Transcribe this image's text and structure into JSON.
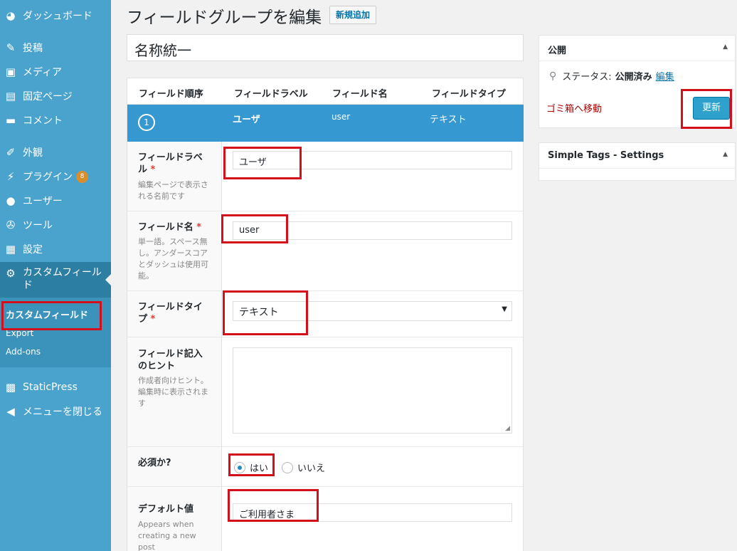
{
  "sidebar": {
    "items": [
      {
        "label": "ダッシュボード",
        "icon": "dashboard-icon"
      },
      {
        "label": "投稿",
        "icon": "pin-icon"
      },
      {
        "label": "メディア",
        "icon": "media-icon"
      },
      {
        "label": "固定ページ",
        "icon": "page-icon"
      },
      {
        "label": "コメント",
        "icon": "comment-icon"
      },
      {
        "label": "外観",
        "icon": "brush-icon"
      },
      {
        "label": "プラグイン",
        "icon": "plugin-icon",
        "badge": "8"
      },
      {
        "label": "ユーザー",
        "icon": "user-icon"
      },
      {
        "label": "ツール",
        "icon": "wrench-icon"
      },
      {
        "label": "設定",
        "icon": "settings-icon"
      },
      {
        "label": "カスタムフィールド",
        "icon": "gear-icon"
      },
      {
        "label": "StaticPress",
        "icon": "staticpress-icon"
      },
      {
        "label": "メニューを閉じる",
        "icon": "collapse-icon"
      }
    ],
    "submenu": [
      {
        "label": "カスタムフィールド"
      },
      {
        "label": "Export"
      },
      {
        "label": "Add-ons"
      }
    ]
  },
  "header": {
    "title": "フィールドグループを編集",
    "add_new": "新規追加"
  },
  "group_title": "名称統一",
  "fields_table": {
    "columns": [
      "フィールド順序",
      "フィールドラベル",
      "フィールド名",
      "フィールドタイプ"
    ],
    "row": {
      "order": "1",
      "label": "ユーザ",
      "name": "user",
      "type": "テキスト"
    }
  },
  "field_edit": {
    "label": {
      "title": "フィールドラベル",
      "required": "*",
      "desc": "編集ページで表示される名前です",
      "value": "ユーザ"
    },
    "name": {
      "title": "フィールド名",
      "required": "*",
      "desc": "単一語。スペース無し。アンダースコアとダッシュは使用可能。",
      "value": "user"
    },
    "type": {
      "title": "フィールドタイプ",
      "required": "*",
      "value": "テキスト"
    },
    "hint": {
      "title": "フィールド記入のヒント",
      "desc": "作成者向けヒント。編集時に表示されます",
      "value": ""
    },
    "required_q": {
      "title": "必須か?",
      "yes": "はい",
      "no": "いいえ",
      "selected": "yes"
    },
    "default": {
      "title": "デフォルト値",
      "desc": "Appears when creating a new post",
      "value": "ご利用者さま"
    }
  },
  "publish_box": {
    "title": "公開",
    "status_label": "ステータス:",
    "status_value": "公開済み",
    "edit_link": "編集",
    "trash": "ゴミ箱へ移動",
    "update": "更新"
  },
  "simple_tags_box": {
    "title": "Simple Tags - Settings"
  },
  "colors": {
    "sidebar": "#4aa3cc",
    "row_highlight": "#3598d0",
    "highlight_box": "#d40f1c",
    "button": "#2ea2cc"
  }
}
